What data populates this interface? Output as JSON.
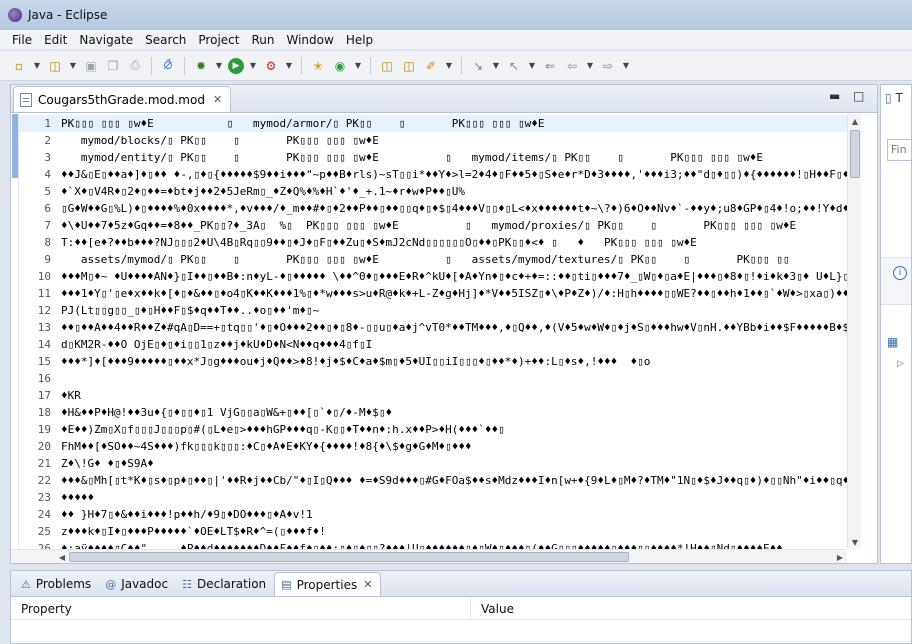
{
  "window": {
    "title": "Java - Eclipse"
  },
  "menu": [
    "File",
    "Edit",
    "Navigate",
    "Search",
    "Project",
    "Run",
    "Window",
    "Help"
  ],
  "toolbar_icons": [
    "new-icon",
    "open-icon",
    "save-icon",
    "save-all-icon",
    "print-icon",
    "skip-breakpoints-icon",
    "debug-icon",
    "run-icon",
    "external-tools-icon",
    "new-java-project-icon",
    "new-class-icon",
    "open-type-icon",
    "open-task-icon",
    "search-icon",
    "next-annotation-icon",
    "prev-annotation-icon",
    "last-edit-icon",
    "back-icon",
    "forward-icon"
  ],
  "editor": {
    "tab_label": "Cougars5thGrade.mod.mod",
    "lines": [
      {
        "n": "1",
        "text": "PK▯▯▯ ▯▯▯ ▯w♦E           ▯   mymod/armor/▯ PK▯▯    ▯       PK▯▯▯ ▯▯▯ ▯w♦E"
      },
      {
        "n": "2",
        "text": "   mymod/blocks/▯ PK▯▯    ▯       PK▯▯▯ ▯▯▯ ▯w♦E"
      },
      {
        "n": "3",
        "text": "   mymod/entity/▯ PK▯▯    ▯       PK▯▯▯ ▯▯▯ ▯w♦E          ▯   mymod/items/▯ PK▯▯    ▯       PK▯▯▯ ▯▯▯ ▯w♦E"
      },
      {
        "n": "4",
        "text": "♦♦J&▯E▯♦♦a♦]♦▯♦♦ ♦-,▯♦▯{♦♦♦♦♦$9♦♦i♦♦♦\"~p♦♦B♦rls)~sT▯▯i*♦♦Y♦>l=2♦4♦▯F♦♦5♦▯S♦e♦r*D♦3♦♦♦♦,'♦♦♦i3;♦♦\"d▯♦▯▯)♦{♦♦♦♦♦♦!▯H♦♦F▯♦♦!♦n"
      },
      {
        "n": "5",
        "text": "♦`X♦▯V4R♦▯2♦▯♦♦=♦bt♦j♦♦2♦5JeRm▯_♦Z♦Q%♦%♦H`♦'♦_+.1~♦r♦w♦P♦♦▯U%"
      },
      {
        "n": "6",
        "text": "▯G♦W♦♦G▯%L)♦▯♦♦♦♦%♦0x♦♦♦♦*,♦v♦♦♦/♦_m♦♦#♦▯♦2♦♦P♦♦▯♦♦▯▯q♦▯♦$▯4♦♦♦V▯▯♦▯L<♦x♦♦♦♦♦♦t♦~\\?♦)6♦O♦♦Nv♦`-♦♦y♦;u8♦GP♦▯4♦!o;♦♦!Y♦d♦M"
      },
      {
        "n": "7",
        "text": "♦\\♦U♦♦7♦5z♦Gq♦♦=♦8♦♦_PK▯▯?♦_3A▯  %▯  PK▯▯▯ ▯▯▯ ▯w♦E          ▯   mymod/proxies/▯ PK▯▯    ▯       PK▯▯▯ ▯▯▯ ▯w♦E"
      },
      {
        "n": "8",
        "text": "T:♦♦[e♦?♦♦b♦♦♦?NJ▯▯▯2♦U\\4B▯Rq▯▯9♦♦▯♦J♦▯F▯♦♦Zu▯♦S♦mJ2cNd▯▯▯▯▯▯O▯♦♦▯PK▯▯♦<♦ ▯   ♦   PK▯▯▯ ▯▯▯ ▯w♦E"
      },
      {
        "n": "9",
        "text": "   assets/mymod/▯ PK▯▯    ▯       PK▯▯▯ ▯▯▯ ▯w♦E          ▯   assets/mymod/textures/▯ PK▯▯    ▯       PK▯▯▯ ▯▯"
      },
      {
        "n": "10",
        "text": "♦♦♦M▯♦~ ♦U♦♦♦♦AN♦}▯I♦♦▯♦♦B♦:n♦yL-♦▯♦♦♦♦♦ \\♦♦^0♦▯♦♦♦E♦R♦^kU♦[♦A♦Yn♦▯♦c♦+♦=::♦♦▯ti▯♦♦♦7♦_▯W▯♦▯a♦E|♦♦♦▯♦8♦▯!♦i♦k♦3▯♦ U♦L}▯♦.mW"
      },
      {
        "n": "11",
        "text": "♦♦♦1♦Y▯'▯e♦x♦♦k♦[♦▯♦&♦♦▯♦o4▯K♦♦K♦♦♦1%▯♦*w♦♦♦s>u♦R@♦k♦+L-Z♦g♦Hj]♦*V♦♦5ISZ▯♦\\♦P♦Z♦)/♦:H▯h♦♦♦♦▯▯WE?♦♦▯♦♦h♦1♦♦▯`♦W♦>▯xa▯)♦♦♦kb)%Du"
      },
      {
        "n": "12",
        "text": "PJ(Lt▯▯g▯▯_▯♦▯H♦♦F▯$♦q♦♦T♦♦..♦o▯♦♦'m♦▯~"
      },
      {
        "n": "13",
        "text": "♦♦▯♦♦A♦♦4♦♦R♦♦Z♦#qA▯D==+▯tq▯▯'♦▯♦O♦♦♦2♦♦▯♦▯8♦-▯▯u▯♦a♦j^vT0*♦♦TM♦♦♦,♦▯Q♦♦,♦(V♦5♦w♦W♦▯♦j♦S▯♦♦♦hw♦V▯nH.♦♦YBb♦i♦♦$F♦♦♦♦♦B♦$♦▯▯)"
      },
      {
        "n": "14",
        "text": "d▯KM2R-♦♦O OjE▯♦▯♦i▯▯1▯z♦♦j♦kU♦D♦N<N♦♦q♦♦♦4▯f▯I"
      },
      {
        "n": "15",
        "text": "♦♦♦*]♦[♦♦♦9♦♦♦♦♦▯♦♦x*J▯g♦♦♦ou♦j♦Q♦♦>♦8!♦j♦$♦C♦a♦$m▯♦5♦UI▯▯iI▯▯▯♦▯♦♦*♦)+♦♦:L▯♦s♦,!♦♦♦  ♦▯o"
      },
      {
        "n": "16",
        "text": ""
      },
      {
        "n": "17",
        "text": "♦KR"
      },
      {
        "n": "18",
        "text": "♦H&♦♦P♦H@!♦♦3u♦{▯♦▯▯♦▯1 VjG▯▯a▯W&+▯♦♦[▯`♦▯/♦-M♦$▯♦"
      },
      {
        "n": "19",
        "text": "♦E♦♦)Zm▯X▯f▯▯▯J▯▯▯p▯#(▯L♦e▯>♦♦♦hGP♦♦♦q▯-K▯▯♦T♦♦n♦:h.x♦♦P>♦H(♦♦♦`♦♦▯"
      },
      {
        "n": "20",
        "text": "FhM♦♦[♦SO♦♦~4S♦♦♦)fk▯▯▯k▯▯▯:♦C▯♦A♦E♦KY♦{♦♦♦♦!♦8{♦\\$♦g♦G♦M♦▯♦♦♦"
      },
      {
        "n": "21",
        "text": "Z♦\\!G♦ ♦▯♦S9A♦"
      },
      {
        "n": "22",
        "text": "♦♦♦&▯Mh[▯t*K♦▯s♦▯p♦▯♦♦▯|'♦♦R♦j♦♦Cb/\"♦▯I▯Q♦♦♦ ♦=♦S9d♦♦♦▯#G♦FOa$♦♦s♦Mdz♦♦♦I♦n[w+♦{9♦L♦▯M♦?♦TM♦\"1N▯♦$♦J♦♦q▯♦)♦▯▯Nh\"♦i♦♦▯q♦♦♦3♦`♦"
      },
      {
        "n": "23",
        "text": "♦♦♦♦♦"
      },
      {
        "n": "24",
        "text": "♦♦ }H♦7▯♦&♦♦i♦♦♦!p♦♦h/♦9▯♦DO♦♦♦▯♦A♦v!1"
      },
      {
        "n": "25",
        "text": "z♦♦♦k♦▯I♦▯♦♦♦P♦♦♦♦♦`♦OE♦LT$♦R♦^=(▯♦♦♦f♦!"
      },
      {
        "n": "26",
        "text": "♦:aÿ♦♦♦♦▯C♦♦\"     ♦P♦♦d♦♦♦♦♦♦♦D♦♦F♦♦f♦▯♦♦:▯♦▯♦▯▯?♦♦♦|U▯♦♦♦♦♦♦▯♦▯W♦▯♦♦♦▯(♦♦G▯▯▯♦♦♦♦♦▯♦♦♦▯▯♦♦♦♦*!H♦♦▯Nd▯♦♦♦♦E♦♦"
      }
    ]
  },
  "right_panel": {
    "tab_label": "T",
    "find_placeholder": "Fin"
  },
  "bottom_panel": {
    "tabs": [
      {
        "label": "Problems",
        "icon": "problems-icon",
        "icon_glyph": "⚠"
      },
      {
        "label": "Javadoc",
        "icon": "javadoc-icon",
        "icon_glyph": "@"
      },
      {
        "label": "Declaration",
        "icon": "declaration-icon",
        "icon_glyph": "☷"
      },
      {
        "label": "Properties",
        "icon": "properties-icon",
        "icon_glyph": "▤"
      }
    ],
    "columns": {
      "property": "Property",
      "value": "Value"
    }
  }
}
